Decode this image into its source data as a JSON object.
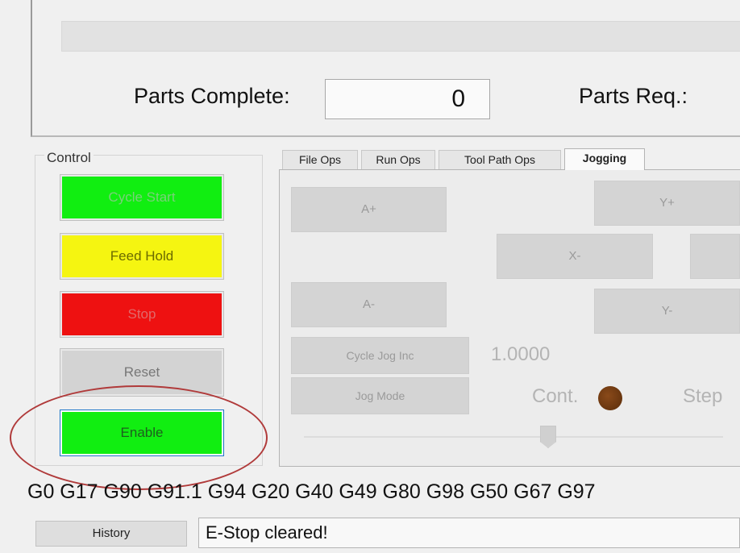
{
  "parts": {
    "complete_label": "Parts Complete:",
    "complete_value": "0",
    "required_label": "Parts Req.:"
  },
  "control": {
    "group_label": "Control",
    "cycle_start": "Cycle Start",
    "feed_hold": "Feed Hold",
    "stop": "Stop",
    "reset": "Reset",
    "enable": "Enable"
  },
  "tabs": [
    {
      "label": "File Ops"
    },
    {
      "label": "Run Ops"
    },
    {
      "label": "Tool Path Ops"
    },
    {
      "label": "Jogging",
      "active": true
    }
  ],
  "jogging": {
    "a_plus": "A+",
    "a_minus": "A-",
    "y_plus": "Y+",
    "y_minus": "Y-",
    "x_minus": "X-",
    "cycle_jog_inc": "Cycle Jog Inc",
    "jog_mode": "Jog Mode",
    "increment_value": "1.0000",
    "cont_label": "Cont.",
    "step_label": "Step"
  },
  "gcode": {
    "modal_line": "G0 G17 G90 G91.1 G94 G20 G40 G49 G80 G98 G50 G67 G97"
  },
  "footer": {
    "history": "History",
    "status_message": "E-Stop cleared!"
  },
  "colors": {
    "cycle_start": "#11ee11",
    "feed_hold": "#f5f511",
    "stop": "#ee1111",
    "reset": "#d3d3d3",
    "enable": "#11ee11",
    "annotation_ellipse": "#b03a3a"
  }
}
